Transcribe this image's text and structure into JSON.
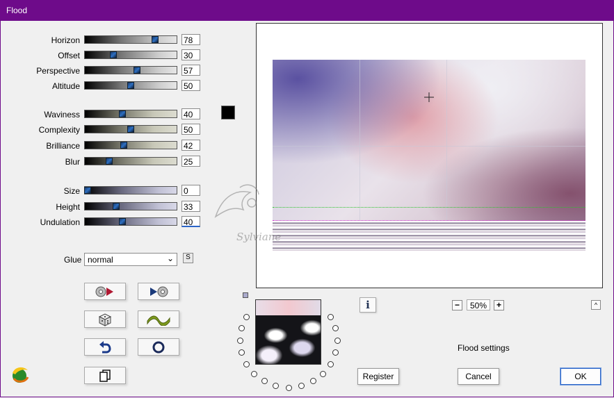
{
  "window": {
    "title": "Flood"
  },
  "sliders": [
    {
      "label": "Horizon",
      "value": "78",
      "style": "gray"
    },
    {
      "label": "Offset",
      "value": "30",
      "style": "gray"
    },
    {
      "label": "Perspective",
      "value": "57",
      "style": "gray"
    },
    {
      "label": "Altitude",
      "value": "50",
      "style": "gray"
    },
    {
      "label": "Waviness",
      "value": "40",
      "style": "olive"
    },
    {
      "label": "Complexity",
      "value": "50",
      "style": "olive"
    },
    {
      "label": "Brilliance",
      "value": "42",
      "style": "olive"
    },
    {
      "label": "Blur",
      "value": "25",
      "style": "olive"
    },
    {
      "label": "Size",
      "value": "0",
      "style": "blue"
    },
    {
      "label": "Height",
      "value": "33",
      "style": "blue"
    },
    {
      "label": "Undulation",
      "value": "40",
      "style": "blue"
    }
  ],
  "color_swatch": "#000000",
  "glue": {
    "label": "Glue",
    "value": "normal",
    "s_button": "S"
  },
  "watermark": {
    "text": "Sylviane"
  },
  "zoom": {
    "value": "50%",
    "minus": "−",
    "plus": "+"
  },
  "info_button": "i",
  "status": "Flood settings",
  "buttons": {
    "register": "Register",
    "cancel": "Cancel",
    "ok": "OK"
  },
  "icons": [
    "reset-to-default-icon",
    "apply-forward-icon",
    "randomize-dice-icon",
    "wave-icon",
    "undo-icon",
    "ring-icon",
    "copy-icon",
    "plugin-logo-icon"
  ]
}
